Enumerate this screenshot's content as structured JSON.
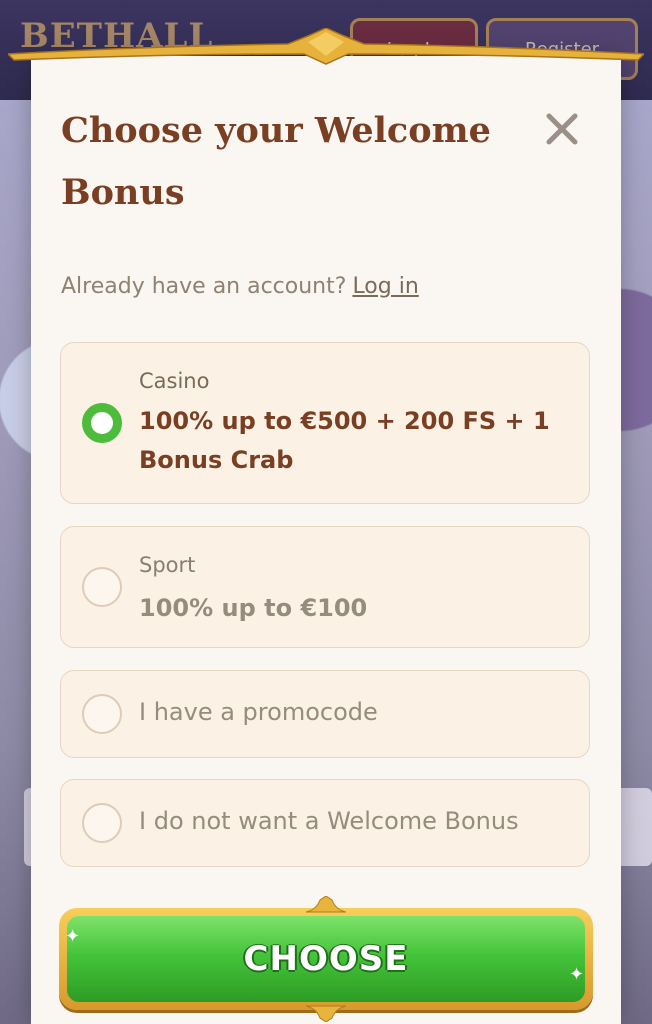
{
  "background": {
    "logo_text": "BETHALL",
    "login_label": "Log In",
    "register_label": "Register"
  },
  "modal": {
    "title": "Choose your Welcome Bonus",
    "close_icon": "close-icon",
    "account_prompt": "Already have an account?",
    "login_link": "Log in",
    "options": [
      {
        "label": "Casino",
        "detail": "100% up to €500 + 200 FS + 1 Bonus Crab",
        "selected": true
      },
      {
        "label": "Sport",
        "detail": "100% up to €100",
        "selected": false
      },
      {
        "label": "I have a promocode",
        "selected": false
      },
      {
        "label": "I do not want a Welcome Bonus",
        "selected": false
      }
    ],
    "choose_label": "CHOOSE"
  },
  "colors": {
    "title": "#7a3f22",
    "selected_radio": "#4cbc3a",
    "button_green": "#45c43a",
    "button_gold": "#d8992c"
  }
}
